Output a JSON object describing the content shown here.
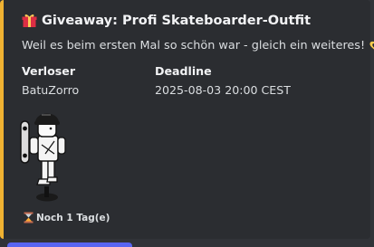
{
  "embed": {
    "accent_color": "#f0b232",
    "title_icon": "gift-icon",
    "title": "Giveaway: Profi Skateboarder-Outfit",
    "description": "Weil es beim ersten Mal so schön war - gleich ein weiteres!",
    "description_icon": "heart-hands-icon",
    "fields": [
      {
        "name": "Verloser",
        "value": "BatuZorro"
      },
      {
        "name": "Deadline",
        "value": "2025-08-03 20:00 CEST"
      }
    ],
    "image_icon": "skateboarder-avatar-icon",
    "footer_icon": "hourglass-icon",
    "footer_text": "Noch 1 Tag(e)"
  }
}
